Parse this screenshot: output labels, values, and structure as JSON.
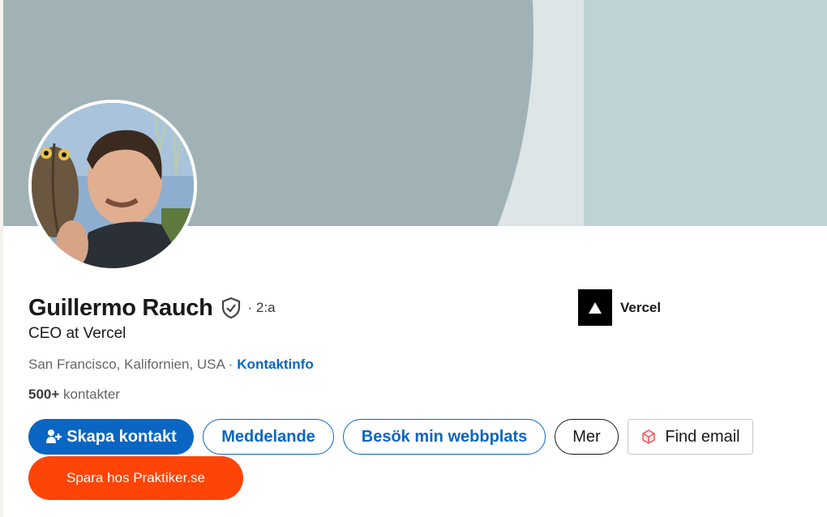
{
  "profile": {
    "name": "Guillermo Rauch",
    "degree": "· 2:a",
    "headline": "CEO at Vercel",
    "location": "San Francisco, Kalifornien, USA ·",
    "contact_info": "Kontaktinfo",
    "connections_count": "500+",
    "connections_label": " kontakter"
  },
  "company": {
    "name": "Vercel",
    "icon": "triangle-logo-icon"
  },
  "actions": {
    "create_contact": "Skapa kontakt",
    "message": "Meddelande",
    "visit_website": "Besök min webbplats",
    "more": "Mer",
    "find_email": "Find email",
    "save_praktiker": "Spara hos Praktiker.se"
  },
  "colors": {
    "linkedin_blue": "#0a66c2",
    "praktiker_orange": "#ff4407",
    "cover_dark": "#a0b2b5",
    "cover_light": "#dde5e6"
  }
}
